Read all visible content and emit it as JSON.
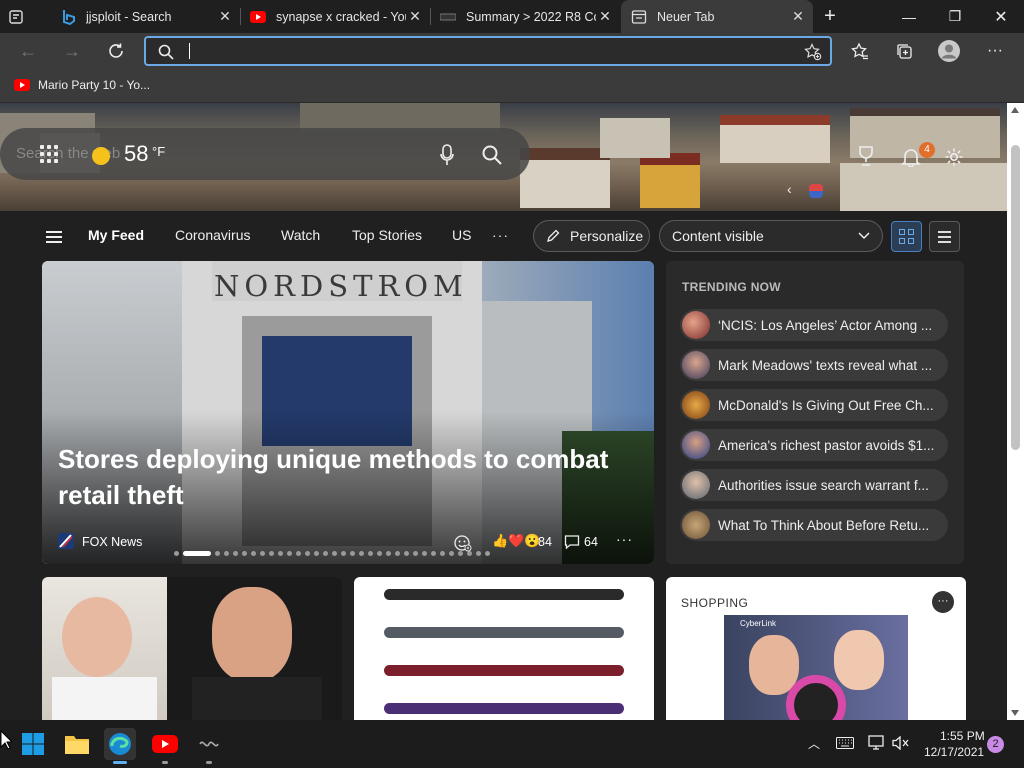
{
  "tabs": [
    {
      "title": "jjsploit - Search"
    },
    {
      "title": "synapse x cracked - You"
    },
    {
      "title": "Summary > 2022 R8 Co"
    },
    {
      "title": "Neuer Tab"
    }
  ],
  "favorites": [
    {
      "label": "Mario Party 10 - Yo..."
    }
  ],
  "header": {
    "search_placeholder": "Search the web",
    "temperature": "58",
    "temp_unit": "°F",
    "notification_count": "4"
  },
  "feed_nav": {
    "items": [
      "My Feed",
      "Coronavirus",
      "Watch",
      "Top Stories",
      "US"
    ],
    "more": "···",
    "personalize": "Personalize",
    "content_visible": "Content visible"
  },
  "main_story": {
    "headline": "Stores deploying unique methods to combat retail theft",
    "source": "FOX News",
    "store_sign": "NORDSTROM",
    "reactions": "84",
    "comments": "64",
    "active_dot": 2,
    "dot_count": 33
  },
  "trending": {
    "title": "TRENDING NOW",
    "items": [
      {
        "text": "‘NCIS: Los Angeles’ Actor Among ..."
      },
      {
        "text": "Mark Meadows' texts reveal what ..."
      },
      {
        "text": "McDonald's Is Giving Out Free Ch..."
      },
      {
        "text": "America's richest pastor avoids $1..."
      },
      {
        "text": "Authorities issue search warrant f..."
      },
      {
        "text": "What To Think About Before Retu..."
      }
    ]
  },
  "shopping": {
    "title": "SHOPPING",
    "ad_brand": "CyberLink"
  },
  "taskbar": {
    "time": "1:55 PM",
    "date": "12/17/2021",
    "notifications": "2"
  },
  "colors": {
    "accent": "#6aa9e6",
    "page_bg": "#202020",
    "card_bg": "#2a2a2a"
  }
}
